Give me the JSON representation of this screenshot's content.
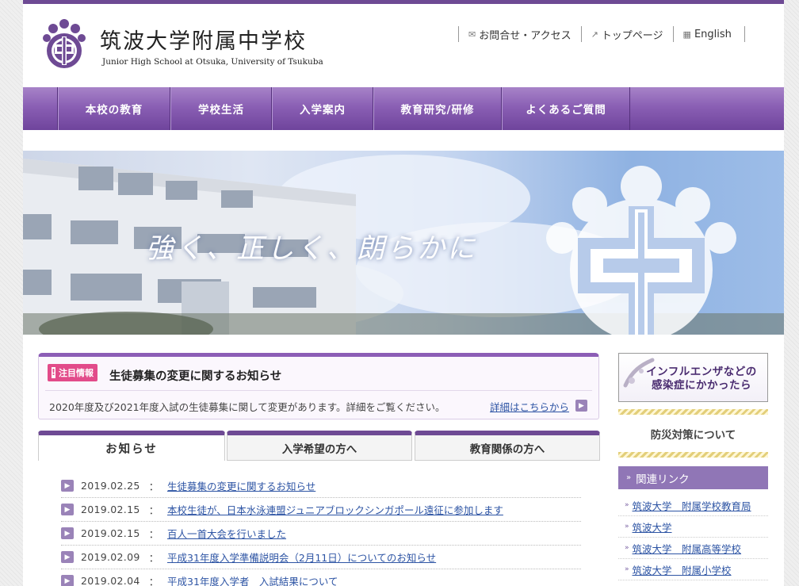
{
  "header": {
    "site_title": "筑波大学附属中学校",
    "site_subtitle": "Junior High School at Otsuka, University of Tsukuba",
    "util_links": [
      {
        "icon": "mail-icon",
        "label": "お問合せ・アクセス"
      },
      {
        "icon": "external-link-icon",
        "label": "トップページ"
      },
      {
        "icon": "english-icon",
        "label": "English"
      }
    ]
  },
  "nav": {
    "items": [
      "本校の教育",
      "学校生活",
      "入学案内",
      "教育研究/研修",
      "よくあるご質問"
    ]
  },
  "hero": {
    "catchphrase": "強く、正しく、朗らかに"
  },
  "notice": {
    "badge": "注目情報",
    "title": "生徒募集の変更に関するお知らせ",
    "body": "2020年度及び2021年度入試の生徒募集に関して変更があります。詳細をご覧ください。",
    "more_link": "詳細はこちらから"
  },
  "tabs": [
    "お知らせ",
    "入学希望の方へ",
    "教育関係の方へ"
  ],
  "news": [
    {
      "date": "2019.02.25",
      "sep": "：",
      "title": "生徒募集の変更に関するお知らせ"
    },
    {
      "date": "2019.02.15",
      "sep": "：",
      "title": "本校生徒が、日本水泳連盟ジュニアブロックシンガポール遠征に参加します"
    },
    {
      "date": "2019.02.15",
      "sep": "：",
      "title": "百人一首大会を行いました"
    },
    {
      "date": "2019.02.09",
      "sep": "：",
      "title": "平成31年度入学準備説明会（2月11日）についてのお知らせ"
    },
    {
      "date": "2019.02.04",
      "sep": "：",
      "title": "平成31年度入学者　入試結果について"
    }
  ],
  "sidebar": {
    "flu_banner_line1": "インフルエンザなどの",
    "flu_banner_line2": "感染症にかかったら",
    "disaster_label": "防災対策について",
    "related_heading": "関連リンク",
    "related_links": [
      "筑波大学　附属学校教育局",
      "筑波大学",
      "筑波大学　附属高等学校",
      "筑波大学　附属小学校"
    ]
  },
  "colors": {
    "brand_purple": "#6e4a94",
    "accent_pink": "#e24b8a",
    "link_blue": "#2d54a4"
  }
}
